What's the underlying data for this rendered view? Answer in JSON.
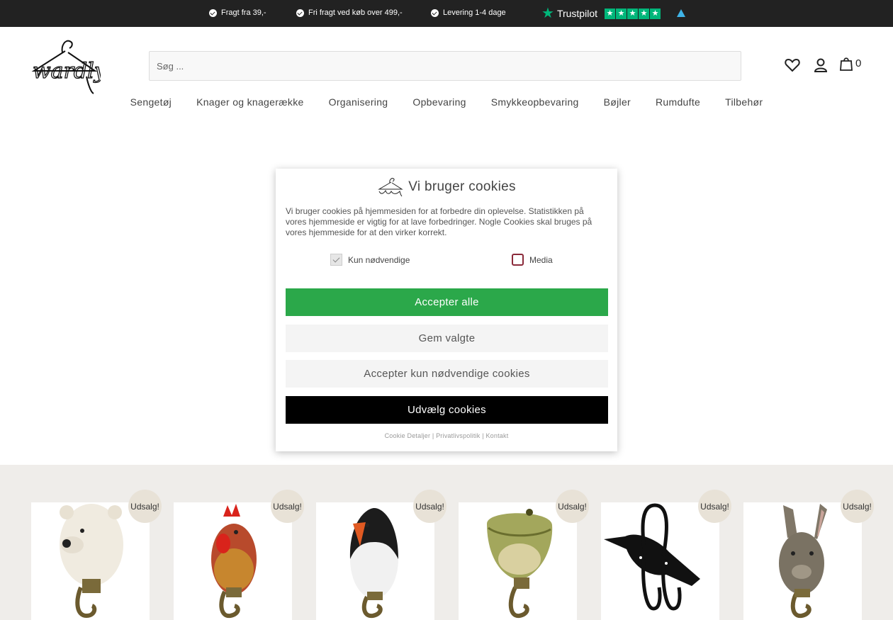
{
  "topbar": {
    "usps": [
      "Fragt fra 39,-",
      "Fri fragt ved køb over 499,-",
      "Levering 1-4 dage"
    ],
    "trustpilot_name": "Trustpilot",
    "trustpilot_rating": 5
  },
  "header": {
    "logo_text": "wardly",
    "search_placeholder": "Søg ...",
    "cart_count": "0"
  },
  "nav": {
    "items": [
      "Sengetøj",
      "Knager og knagerække",
      "Organisering",
      "Opbevaring",
      "Smykkeopbevaring",
      "Bøjler",
      "Rumdufte",
      "Tilbehør"
    ]
  },
  "cookie": {
    "title": "Vi bruger cookies",
    "text": "Vi bruger cookies på hjemmesiden for at forbedre din oplevelse. Statistikken på vores hjemmeside er vigtig for at lave forbedringer. Nogle Cookies skal bruges på vores hjemmeside for at den virker korrekt.",
    "option_necessary": "Kun nødvendige",
    "option_media": "Media",
    "accept_all": "Accepter alle",
    "save_selected": "Gem valgte",
    "accept_necessary": "Accepter kun nødvendige cookies",
    "select_cookies": "Udvælg cookies",
    "link_details": "Cookie Detaljer",
    "link_privacy": "Privatlivspolitik",
    "link_contact": "Kontakt",
    "separator": "|"
  },
  "products": {
    "sale_badge": "Udsalg!",
    "items": [
      "polar-bear-hook",
      "rooster-hook",
      "puffin-hook",
      "crocodile-hook",
      "bird-coat-hook",
      "hare-hook"
    ]
  },
  "colors": {
    "topbar_bg": "#222222",
    "accept_green": "#2ba84a",
    "trustpilot_green": "#00b67a",
    "section_bg": "#efedea",
    "sale_badge_bg": "#e8e2d7"
  }
}
